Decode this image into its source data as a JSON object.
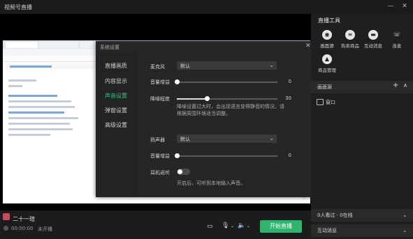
{
  "app": {
    "title": "视频号直播",
    "minimize": "—",
    "close": "✕"
  },
  "settings": {
    "title": "系统设置",
    "close": "✕",
    "nav": [
      "直播画质",
      "内容显示",
      "声音设置",
      "弹窗设置",
      "高级设置"
    ],
    "active_nav": 2,
    "microphone": {
      "label": "麦克风",
      "value": "默认"
    },
    "mic_volume": {
      "label": "音量增益",
      "value": "0"
    },
    "noise": {
      "label": "降噪程度",
      "value": "30",
      "level": 0.3,
      "hint": "降噪设置过大时，会出现语言变得静音的情况，请根据周围环境适当调整。"
    },
    "speaker": {
      "label": "扬声器",
      "value": "默认"
    },
    "speaker_volume": {
      "label": "音量增益",
      "value": "0"
    },
    "ear_monitor": {
      "label": "耳机返听",
      "on": false,
      "hint": "开启后，可听到本地输入声音。"
    }
  },
  "right_panel": {
    "tools_title": "直播工具",
    "tools": [
      {
        "label": "画面源",
        "icon": "camera-icon"
      },
      {
        "label": "热卖商品",
        "icon": "list-icon"
      },
      {
        "label": "互动消息",
        "icon": "chat-icon"
      },
      {
        "label": "连麦",
        "icon": "phone-icon"
      },
      {
        "label": "商品管理",
        "icon": "bag-icon"
      }
    ],
    "scene_title": "画面源",
    "scene_add": "+",
    "scene_collapse": "∧",
    "scene_item": "窗口",
    "stats": "0人看过 · 0在线",
    "messages": "互动消息"
  },
  "bottom": {
    "user_name": "二十一瑄",
    "time": "00:00:00",
    "status": "未开播",
    "start_button": "开始直播"
  },
  "colors": {
    "accent": "#33c37a",
    "start": "#2eb46d"
  }
}
